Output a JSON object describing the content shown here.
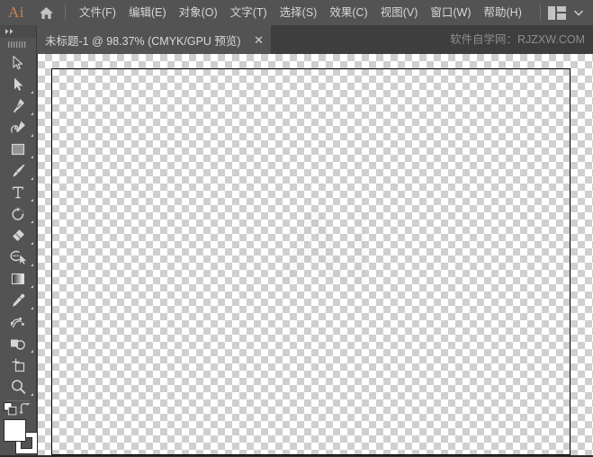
{
  "app": {
    "name": "Ai",
    "logo_color": "#c8825a"
  },
  "menubar": {
    "home_icon": "home-icon",
    "items": [
      {
        "label": "文件(F)"
      },
      {
        "label": "编辑(E)"
      },
      {
        "label": "对象(O)"
      },
      {
        "label": "文字(T)"
      },
      {
        "label": "选择(S)"
      },
      {
        "label": "效果(C)"
      },
      {
        "label": "视图(V)"
      },
      {
        "label": "窗口(W)"
      },
      {
        "label": "帮助(H)"
      }
    ],
    "workspace_switcher_icon": "workspace-layout-icon",
    "workspace_chevron_icon": "chevron-down-icon"
  },
  "tabbar": {
    "tab_title": "未标题-1 @ 98.37% (CMYK/GPU 预览)",
    "close_label": "✕",
    "watermark": "软件自学网：RJZXW.COM"
  },
  "toolbar": {
    "collapse_icon": "double-chevron-right-icon",
    "grip_icon": "drag-grip-icon",
    "tools": [
      {
        "name": "selection-tool",
        "icon": "arrow-cursor-icon",
        "has_flyout": false,
        "selected": false
      },
      {
        "name": "direct-selection-tool",
        "icon": "filled-arrow-cursor-icon",
        "has_flyout": true,
        "selected": false
      },
      {
        "name": "pen-tool",
        "icon": "pen-nib-icon",
        "has_flyout": true,
        "selected": false
      },
      {
        "name": "curvature-tool",
        "icon": "curvature-pen-icon",
        "has_flyout": true,
        "selected": false
      },
      {
        "name": "rectangle-tool",
        "icon": "rectangle-icon",
        "has_flyout": true,
        "selected": false
      },
      {
        "name": "paintbrush-tool",
        "icon": "paintbrush-icon",
        "has_flyout": true,
        "selected": false
      },
      {
        "name": "type-tool",
        "icon": "type-t-icon",
        "has_flyout": true,
        "selected": false
      },
      {
        "name": "rotate-tool",
        "icon": "rotate-arc-icon",
        "has_flyout": true,
        "selected": false
      },
      {
        "name": "eraser-tool",
        "icon": "eraser-icon",
        "has_flyout": true,
        "selected": false
      },
      {
        "name": "shaper-tool",
        "icon": "lasso-shaper-icon",
        "has_flyout": true,
        "selected": false
      },
      {
        "name": "gradient-tool",
        "icon": "gradient-swatch-icon",
        "has_flyout": true,
        "selected": false
      },
      {
        "name": "eyedropper-tool",
        "icon": "eyedropper-icon",
        "has_flyout": true,
        "selected": false
      },
      {
        "name": "blend-tool",
        "icon": "blend-icon",
        "has_flyout": false,
        "selected": false
      },
      {
        "name": "shape-builder-tool",
        "icon": "shape-builder-icon",
        "has_flyout": true,
        "selected": false
      },
      {
        "name": "artboard-tool",
        "icon": "artboard-icon",
        "has_flyout": false,
        "selected": false
      },
      {
        "name": "zoom-tool",
        "icon": "magnifier-icon",
        "has_flyout": true,
        "selected": false
      }
    ],
    "default_colors_icon": "default-fill-stroke-icon",
    "swap_colors_icon": "swap-fill-stroke-icon",
    "fill_color": "#ffffff",
    "stroke_color": "#ffffff"
  },
  "canvas": {
    "artboard_label": "artboard-1",
    "background": "transparency-checkerboard"
  }
}
